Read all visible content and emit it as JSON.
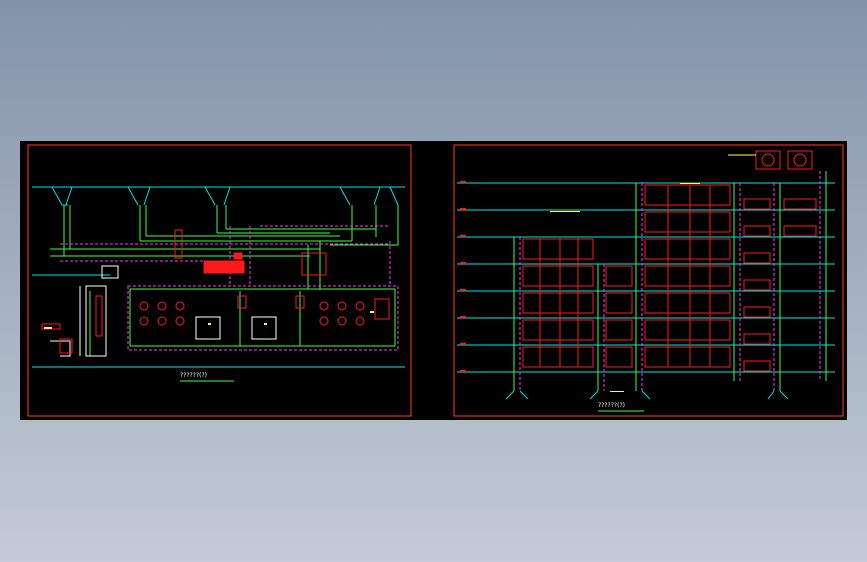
{
  "viewer": {
    "background_top": "#8393a8",
    "background_bottom": "#c3ccd6",
    "canvas_color": "#000000"
  },
  "colors": {
    "frame": "#ff3b1f",
    "riser": "#00e6e6",
    "pipe_green": "#3cff3c",
    "pipe_magenta": "#ff33ff",
    "equipment_red": "#ff1a1a",
    "yellow": "#ffff33",
    "white": "#ffffff"
  },
  "sheets": [
    {
      "id": "left",
      "title": "??????(?)"
    },
    {
      "id": "right",
      "title": "??????(?)"
    }
  ]
}
